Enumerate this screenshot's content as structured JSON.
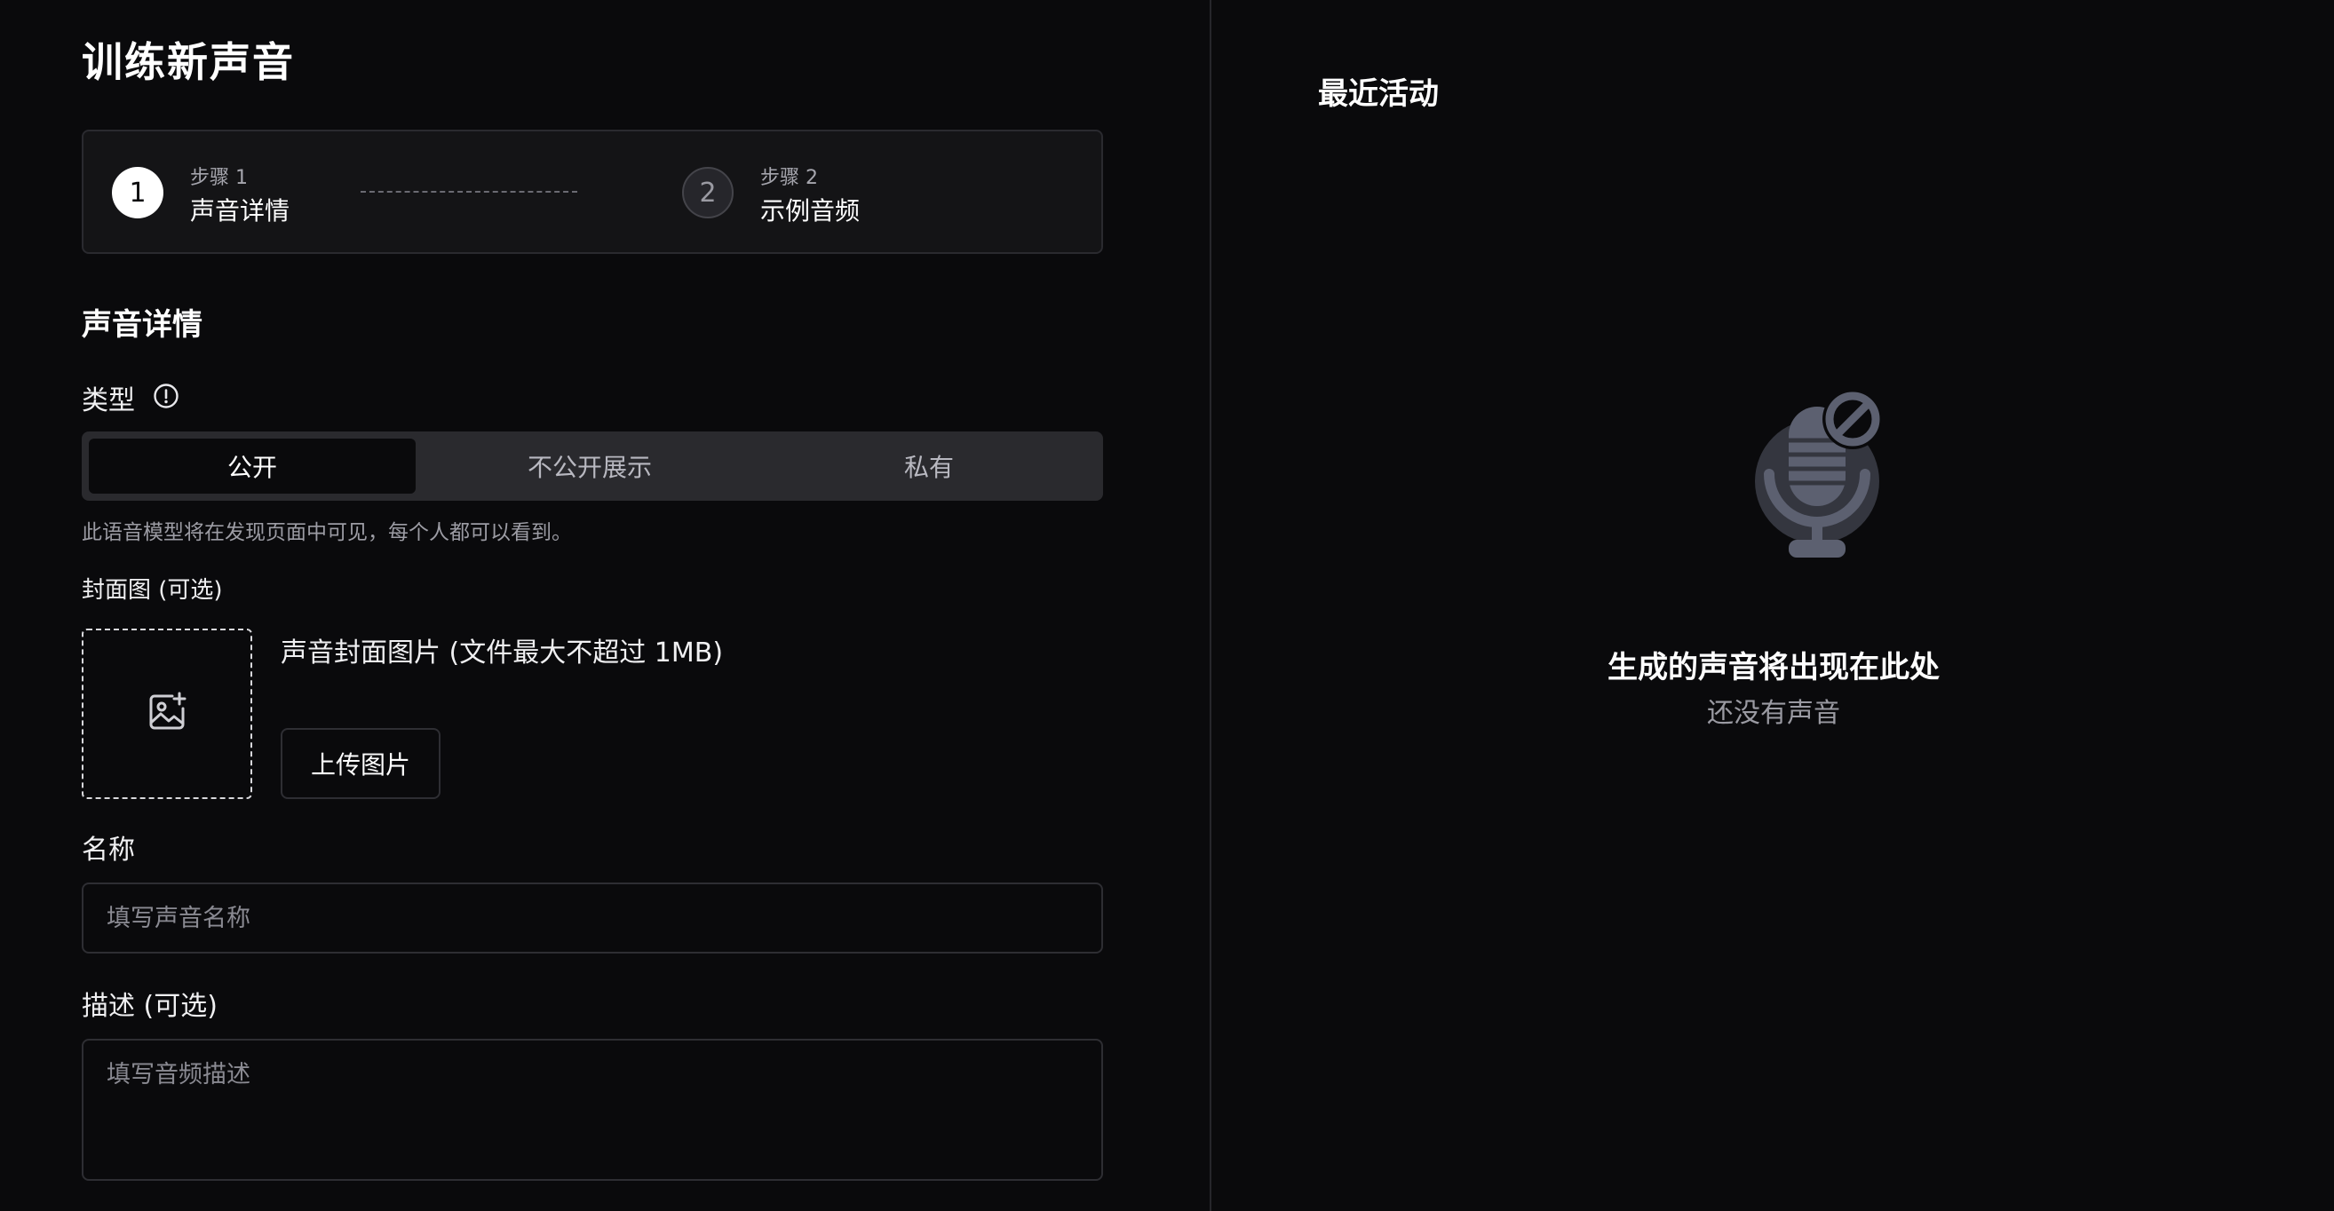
{
  "page": {
    "title": "训练新声音"
  },
  "stepper": {
    "steps": [
      {
        "number": "1",
        "caption": "步骤 1",
        "label": "声音详情"
      },
      {
        "number": "2",
        "caption": "步骤 2",
        "label": "示例音频"
      }
    ],
    "active_step": 1
  },
  "form": {
    "section_title": "声音详情",
    "type": {
      "label": "类型",
      "options": [
        "公开",
        "不公开展示",
        "私有"
      ],
      "selected": "公开",
      "hint": "此语音模型将在发现页面中可见，每个人都可以看到。"
    },
    "cover": {
      "label": "封面图 (可选)",
      "caption": "声音封面图片 (文件最大不超过 1MB)",
      "upload_button": "上传图片"
    },
    "name": {
      "label": "名称",
      "placeholder": "填写声音名称",
      "value": ""
    },
    "description": {
      "label": "描述 (可选)",
      "placeholder": "填写音频描述",
      "value": ""
    }
  },
  "activity": {
    "title": "最近活动",
    "empty_title": "生成的声音将出现在此处",
    "empty_subtitle": "还没有声音"
  },
  "icons": {
    "info": "info-circle-icon",
    "add_image": "image-plus-icon",
    "empty_state": "microphone-off-icon"
  },
  "colors": {
    "background": "#0a0a0c",
    "panel": "#141416",
    "border": "#2a2a2f",
    "segment_bg": "#2a2a2e",
    "muted_text": "#9a9aa2",
    "mic_fill": "#5c6070"
  }
}
